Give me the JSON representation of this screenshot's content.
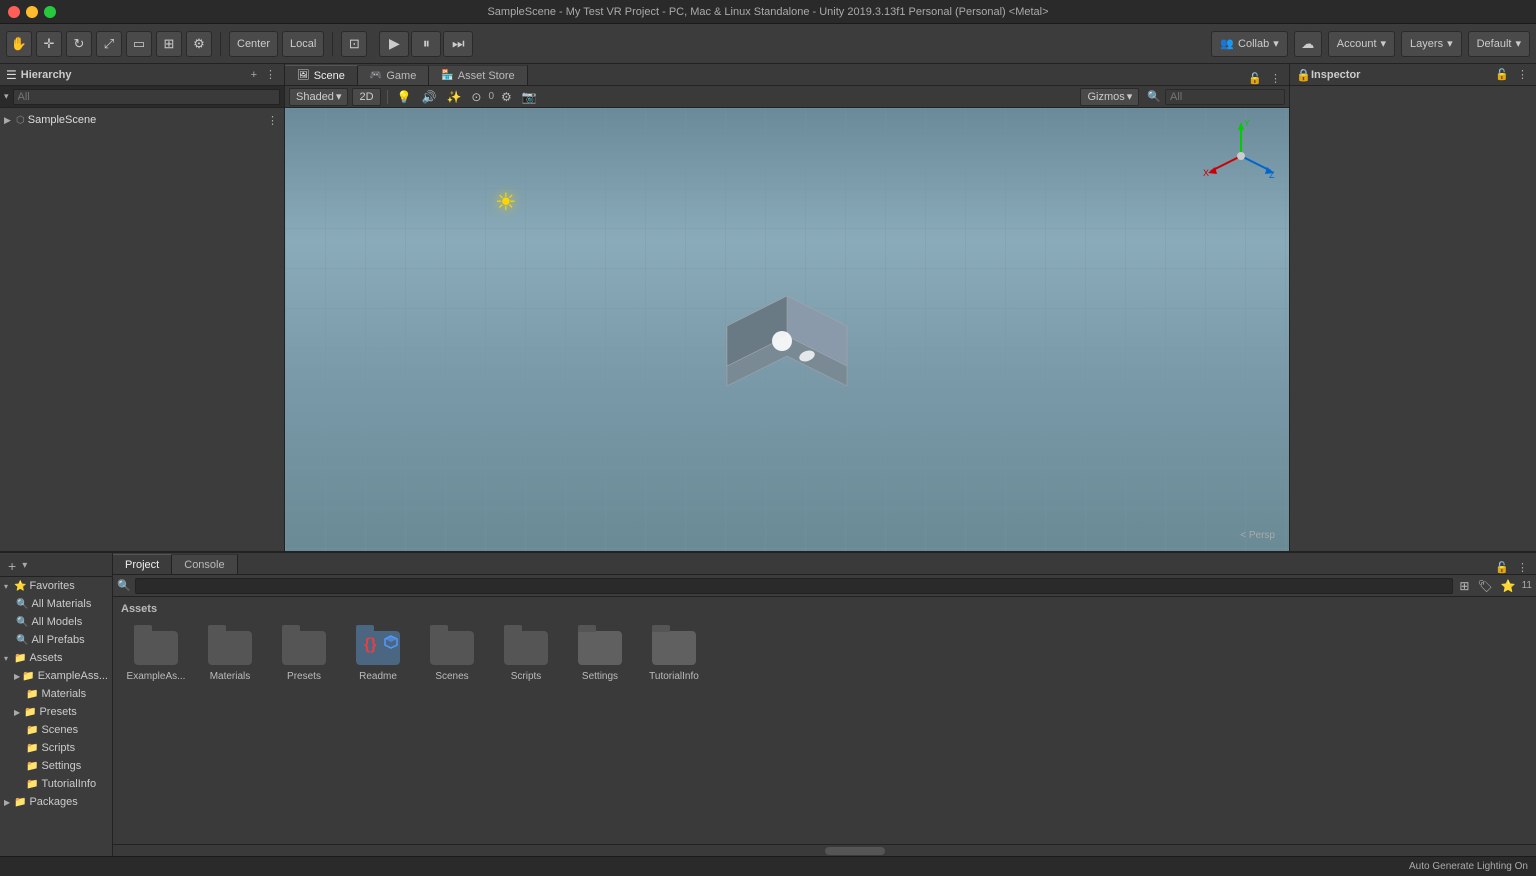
{
  "window": {
    "title": "SampleScene - My Test VR Project - PC, Mac & Linux Standalone - Unity 2019.3.13f1 Personal (Personal) <Metal>"
  },
  "toolbar": {
    "transform_tools": [
      "hand",
      "move",
      "rotate",
      "scale",
      "rect",
      "transform"
    ],
    "pivot_mode": "Center",
    "pivot_space": "Local",
    "custom_tool": "⚙",
    "play": "▶",
    "pause": "⏸",
    "step": "⏭",
    "collab": "Collab",
    "account": "Account",
    "layers": "Layers",
    "layout": "Default"
  },
  "hierarchy": {
    "title": "Hierarchy",
    "search_placeholder": "All",
    "items": [
      {
        "label": "SampleScene",
        "type": "scene",
        "expanded": true
      }
    ]
  },
  "scene": {
    "tabs": [
      {
        "label": "Scene",
        "icon": "🖼",
        "active": true
      },
      {
        "label": "Game",
        "icon": "🎮",
        "active": false
      },
      {
        "label": "Asset Store",
        "icon": "🏪",
        "active": false
      }
    ],
    "shading": "Shaded",
    "view_2d": "2D",
    "gizmos": "Gizmos",
    "search_all": "All",
    "persp_label": "< Persp"
  },
  "inspector": {
    "title": "Inspector"
  },
  "project_panel": {
    "tabs": [
      {
        "label": "Project",
        "icon": "📁",
        "active": true
      },
      {
        "label": "Console",
        "icon": "📋",
        "active": false
      }
    ],
    "assets_title": "Assets",
    "item_count": "11",
    "folders": [
      {
        "label": "ExampleAs...",
        "type": "folder"
      },
      {
        "label": "Materials",
        "type": "folder"
      },
      {
        "label": "Presets",
        "type": "folder"
      },
      {
        "label": "Readme",
        "type": "readme"
      },
      {
        "label": "Scenes",
        "type": "folder"
      },
      {
        "label": "Scripts",
        "type": "folder"
      },
      {
        "label": "Settings",
        "type": "folder"
      },
      {
        "label": "TutorialInfo",
        "type": "folder"
      }
    ]
  },
  "project_tree": {
    "favorites": {
      "label": "Favorites",
      "items": [
        {
          "label": "All Materials"
        },
        {
          "label": "All Models"
        },
        {
          "label": "All Prefabs"
        }
      ]
    },
    "assets": {
      "label": "Assets",
      "items": [
        {
          "label": "ExampleAss...",
          "depth": 1
        },
        {
          "label": "Materials",
          "depth": 1
        },
        {
          "label": "Presets",
          "depth": 1,
          "expanded": false
        },
        {
          "label": "Scenes",
          "depth": 1
        },
        {
          "label": "Scripts",
          "depth": 1
        },
        {
          "label": "Settings",
          "depth": 1
        },
        {
          "label": "TutorialInfo",
          "depth": 1
        }
      ]
    },
    "packages": {
      "label": "Packages"
    }
  },
  "status_bar": {
    "text": "Auto Generate Lighting On"
  }
}
